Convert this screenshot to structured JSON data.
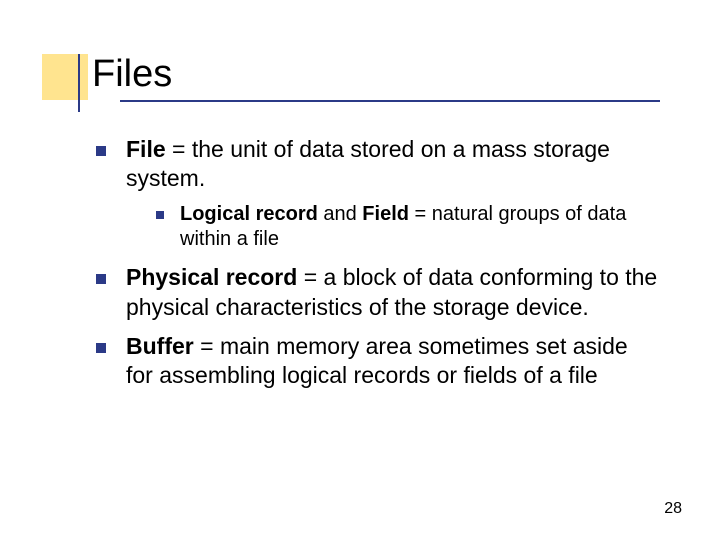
{
  "title": "Files",
  "bullets": {
    "b1_bold": "File",
    "b1_rest": " = the unit of data stored on a mass storage system.",
    "b1_sub_bold1": "Logical record",
    "b1_sub_mid": " and ",
    "b1_sub_bold2": "Field",
    "b1_sub_rest": " = natural groups of data within a file",
    "b2_bold": "Physical record",
    "b2_rest": " = a block of data conforming to the physical characteristics of the storage device.",
    "b3_bold": "Buffer",
    "b3_rest": " = main memory area sometimes set aside for assembling logical records or fields of a file"
  },
  "page_number": "28"
}
